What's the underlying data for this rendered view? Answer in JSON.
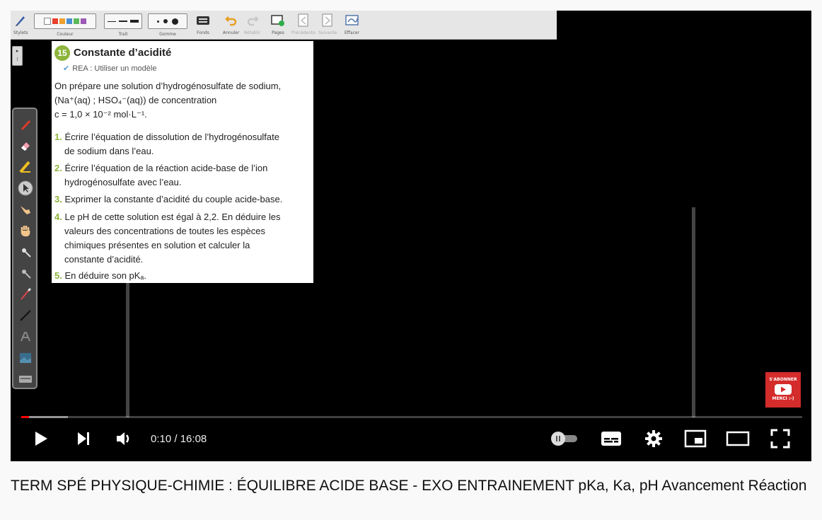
{
  "toolbar": {
    "groups": [
      {
        "label": "Stylets"
      },
      {
        "label": "Couleur"
      },
      {
        "label": "Trait"
      },
      {
        "label": "Gomme"
      },
      {
        "label": "Fonds"
      },
      {
        "label": "Annuler"
      },
      {
        "label": "Rétablir"
      },
      {
        "label": "Pages"
      },
      {
        "label": "Précédente"
      },
      {
        "label": "Suivante"
      },
      {
        "label": "Effacer"
      }
    ],
    "colors": [
      "#ffffff",
      "#e8412c",
      "#f0a030",
      "#4a90d0",
      "#5bb85b",
      "#9b59b6"
    ]
  },
  "exercise": {
    "number": "15",
    "title": "Constante d’acidité",
    "skill": "REA : Utiliser un modèle",
    "intro_line1": "On prépare une solution d’hydrogénosulfate de sodium,",
    "intro_line2": "(Na⁺(aq) ; HSO₄⁻(aq)) de concentration",
    "intro_line3": "c = 1,0 × 10⁻² mol·L⁻¹.",
    "questions": [
      {
        "num": "1.",
        "line1": "Écrire l’équation de dissolution de l’hydrogénosulfate",
        "line2": "de sodium dans l’eau."
      },
      {
        "num": "2.",
        "line1": "Écrire l’équation de la réaction acide-base de l’ion",
        "line2": "hydrogénosulfate avec l’eau."
      },
      {
        "num": "3.",
        "line1": "Exprimer la constante d’acidité du couple acide-base."
      },
      {
        "num": "4.",
        "line1": "Le pH de cette solution est égal à 2,2. En déduire les",
        "line2": "valeurs des concentrations de toutes les espèces",
        "line3": "chimiques présentes en solution et calculer la",
        "line4": "constante d’acidité."
      },
      {
        "num": "5.",
        "line1": "En déduire son pKₐ."
      }
    ]
  },
  "subscribe": {
    "line1": "S'ABONNER",
    "line2": "MERCI :-)"
  },
  "player": {
    "current_time": "0:10",
    "separator": " / ",
    "duration": "16:08",
    "progress_fraction": 0.0103,
    "buffered_fraction": 0.06
  },
  "video": {
    "title": "TERM SPÉ PHYSIQUE-CHIMIE : ÉQUILIBRE ACIDE BASE - EXO ENTRAINEMENT pKa, Ka, pH Avancement Réaction"
  }
}
